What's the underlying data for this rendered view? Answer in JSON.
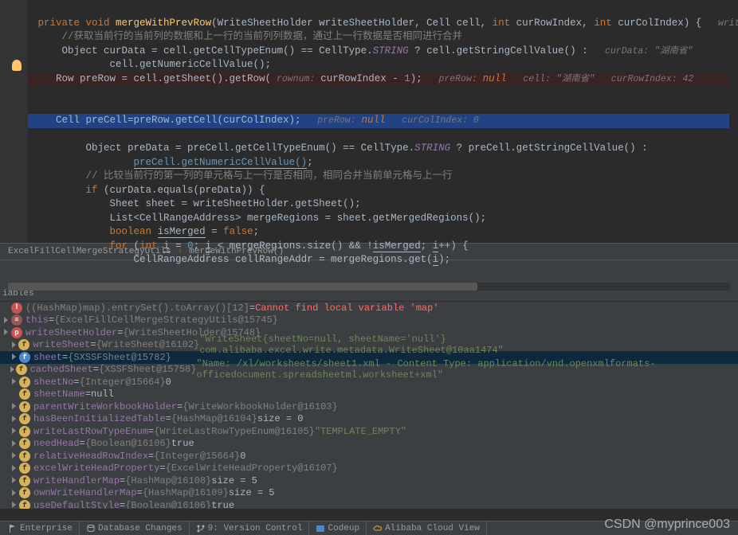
{
  "code": {
    "l1_kw1": "private void",
    "l1_meth": "mergeWithPrevRow",
    "l1_params": "(WriteSheetHolder writeSheetHolder, Cell cell, ",
    "l1_kw2": "int",
    "l1_p2": " curRowIndex, ",
    "l1_kw3": "int",
    "l1_p3": " curColIndex) {",
    "l1_hint": "   writeSheetHold",
    "l2": "    //获取当前行的当前列的数据和上一行的当前列列数据，通过上一行数据是否相同进行合并",
    "l3_1": "    Object curData = cell.getCellTypeEnum() == CellType.",
    "l3_field": "STRING",
    "l3_2": " ? cell.getStringCellValue() : ",
    "l3_hint": "  curData: \"湖南省\"",
    "l4": "            cell.getNumericCellValue();",
    "l5_1": "    Row preRow = cell.getSheet().getRow(",
    "l5_hint1": " rownum: ",
    "l5_2": "curRowIndex - ",
    "l5_num": "1",
    "l5_3": ");",
    "l5_hint2": "   preRow: ",
    "l5_null": "null",
    "l5_hint3": "   cell: \"湖南省\"   curRowIndex: 42",
    "l6": "",
    "l7_1": "    Cell preCell=preRow.getCell(curColIndex);",
    "l7_hint": "   preRow: ",
    "l7_null": "null",
    "l7_hint2": "   curColIndex: 0",
    "l8_1": "        Object preData = preCell.getCellTypeEnum() == CellType.",
    "l8_field": "STRING",
    "l8_2": " ? preCell.getStringCellValue() :",
    "l9_1": "                ",
    "l9_u": "preCell.getNumericCellValue()",
    "l9_2": ";",
    "l10": "        // 比较当前行的第一列的单元格与上一行是否相同，相同合并当前单元格与上一行",
    "l11_kw": "if",
    "l11_1": " (curData.equals(preData)) {",
    "l12": "            Sheet sheet = writeSheetHolder.getSheet();",
    "l13": "            List<CellRangeAddress> mergeRegions = sheet.getMergedRegions();",
    "l14_kw": "boolean",
    "l14_1": " ",
    "l14_u": "isMerged",
    "l14_2": " = ",
    "l14_kw2": "false",
    "l14_3": ";",
    "l15_kw": "for",
    "l15_1": " (",
    "l15_kw2": "int",
    "l15_2": " ",
    "l15_u": "i",
    "l15_3": " = ",
    "l15_n1": "0",
    "l15_4": "; ",
    "l15_u2": "i",
    "l15_5": " < mergeRegions.size() && !",
    "l15_u3": "isMerged",
    "l15_6": "; ",
    "l15_u4": "i",
    "l15_7": "++) {",
    "l16_1": "                CellRangeAddress cellRangeAddr = mergeRegions.get(",
    "l16_u": "i",
    "l16_2": ");"
  },
  "breadcrumb": {
    "part1": "ExcelFillCellMergeStrategyUtils",
    "part2": "mergeWithPrevRow()"
  },
  "varsHeader": "iables",
  "vars": [
    {
      "depth": 0,
      "badge": "err",
      "name": "",
      "text1": "((HashMap)map).entrySet().toArray()[12]",
      "eq": " = ",
      "err": "Cannot find local variable 'map'"
    },
    {
      "depth": 0,
      "badge": "misc",
      "name": "this",
      "eq": " = ",
      "val": "{ExcelFillCellMergeStrategyUtils@15745}",
      "expand": true
    },
    {
      "depth": 0,
      "badge": "p",
      "name": "writeSheetHolder",
      "eq": " = ",
      "val": "{WriteSheetHolder@15748}",
      "expand": true
    },
    {
      "depth": 1,
      "badge": "f",
      "name": "writeSheet",
      "eq": " = ",
      "val": "{WriteSheet@16102} ",
      "str": "\"WriteSheet{sheetNo=null, sheetName='null'} com.alibaba.excel.write.metadata.WriteSheet@10aa1474\"",
      "expand": true
    },
    {
      "depth": 1,
      "badge": "foo",
      "name": "sheet",
      "eq": " = ",
      "val": "{SXSSFSheet@15782}",
      "expand": true,
      "selected": true
    },
    {
      "depth": 1,
      "badge": "f",
      "name": "cachedSheet",
      "eq": " = ",
      "val": "{XSSFSheet@15758} ",
      "str": "\"Name: /xl/worksheets/sheet1.xml - Content Type: application/vnd.openxmlformats-officedocument.spreadsheetml.worksheet+xml\"",
      "expand": true
    },
    {
      "depth": 1,
      "badge": "f",
      "name": "sheetNo",
      "eq": " = ",
      "val": "{Integer@15664} ",
      "plain": "0",
      "expand": true
    },
    {
      "depth": 1,
      "badge": "f",
      "name": "sheetName",
      "eq": " = ",
      "plain": "null"
    },
    {
      "depth": 1,
      "badge": "f",
      "name": "parentWriteWorkbookHolder",
      "eq": " = ",
      "val": "{WriteWorkbookHolder@16103}",
      "expand": true
    },
    {
      "depth": 1,
      "badge": "f",
      "name": "hasBeenInitializedTable",
      "eq": " = ",
      "val": "{HashMap@16104}  ",
      "plain": "size = 0",
      "expand": true
    },
    {
      "depth": 1,
      "badge": "f",
      "name": "writeLastRowTypeEnum",
      "eq": " = ",
      "val": "{WriteLastRowTypeEnum@16105} ",
      "str": "\"TEMPLATE_EMPTY\"",
      "expand": true
    },
    {
      "depth": 1,
      "badge": "f",
      "name": "needHead",
      "eq": " = ",
      "val": "{Boolean@16106} ",
      "plain": "true",
      "expand": true
    },
    {
      "depth": 1,
      "badge": "f",
      "name": "relativeHeadRowIndex",
      "eq": " = ",
      "val": "{Integer@15664} ",
      "plain": "0",
      "expand": true
    },
    {
      "depth": 1,
      "badge": "f",
      "name": "excelWriteHeadProperty",
      "eq": " = ",
      "val": "{ExcelWriteHeadProperty@16107}",
      "expand": true
    },
    {
      "depth": 1,
      "badge": "f",
      "name": "writeHandlerMap",
      "eq": " = ",
      "val": "{HashMap@16108}  ",
      "plain": "size = 5",
      "expand": true
    },
    {
      "depth": 1,
      "badge": "f",
      "name": "ownWriteHandlerMap",
      "eq": " = ",
      "val": "{HashMap@16109}  ",
      "plain": "size = 5",
      "expand": true
    },
    {
      "depth": 1,
      "badge": "f",
      "name": "useDefaultStyle",
      "eq": " = ",
      "val": "{Boolean@16106} ",
      "plain": "true",
      "expand": true
    }
  ],
  "statusbar": {
    "enterprise": "Enterprise",
    "db": "Database Changes",
    "vc": "9: Version Control",
    "codeup": "Codeup",
    "aliyun": "Alibaba Cloud View"
  },
  "watermark": "CSDN @myprince003"
}
